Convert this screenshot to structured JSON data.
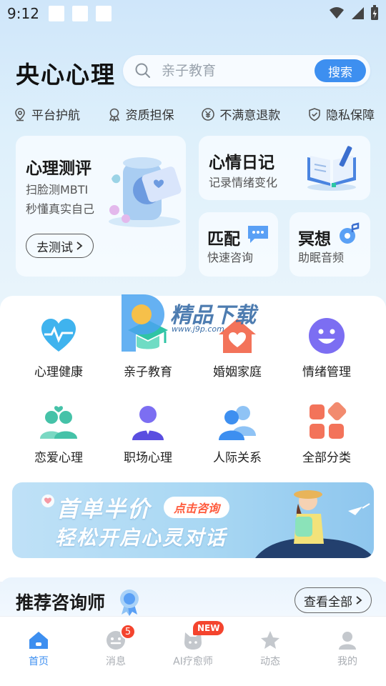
{
  "status_bar": {
    "time": "9:12"
  },
  "header": {
    "app_title": "央心心理",
    "search": {
      "placeholder": "亲子教育",
      "button_label": "搜索"
    }
  },
  "guarantees": [
    {
      "label": "平台护航",
      "icon": "location-shield-icon"
    },
    {
      "label": "资质担保",
      "icon": "certificate-icon"
    },
    {
      "label": "不满意退款",
      "icon": "yen-icon"
    },
    {
      "label": "隐私保障",
      "icon": "privacy-shield-icon"
    }
  ],
  "feature_cards": {
    "assessment": {
      "title": "心理测评",
      "line1": "扫脸测MBTI",
      "line2": "秒懂真实自己",
      "button_label": "去测试"
    },
    "diary": {
      "title": "心情日记",
      "subtitle": "记录情绪变化"
    },
    "match": {
      "title": "匹配",
      "subtitle": "快速咨询"
    },
    "meditation": {
      "title": "冥想",
      "subtitle": "助眠音频"
    }
  },
  "categories": [
    {
      "label": "心理健康",
      "icon": "heart-pulse-icon"
    },
    {
      "label": "亲子教育",
      "icon": "graduation-cap-icon"
    },
    {
      "label": "婚姻家庭",
      "icon": "house-heart-icon"
    },
    {
      "label": "情绪管理",
      "icon": "smiley-icon"
    },
    {
      "label": "恋爱心理",
      "icon": "couple-icon"
    },
    {
      "label": "职场心理",
      "icon": "professional-icon"
    },
    {
      "label": "人际关系",
      "icon": "people-icon"
    },
    {
      "label": "全部分类",
      "icon": "grid-icon"
    }
  ],
  "banner": {
    "line1": "首单半价",
    "line2": "轻松开启心灵对话",
    "cta": "点击咨询"
  },
  "recommended": {
    "title": "推荐咨询师",
    "view_all": "查看全部"
  },
  "watermark": {
    "text": "精品下载",
    "url": "www.j9p.com"
  },
  "tab_bar": [
    {
      "label": "首页",
      "icon": "home-icon",
      "active": true
    },
    {
      "label": "消息",
      "icon": "message-icon",
      "badge": "5"
    },
    {
      "label": "AI疗愈师",
      "icon": "ai-cat-icon",
      "badge": "NEW"
    },
    {
      "label": "动态",
      "icon": "star-icon"
    },
    {
      "label": "我的",
      "icon": "user-icon"
    }
  ],
  "colors": {
    "accent": "#3d8ff0",
    "badge": "#f4442e",
    "tab_inactive": "#a9adb3"
  }
}
